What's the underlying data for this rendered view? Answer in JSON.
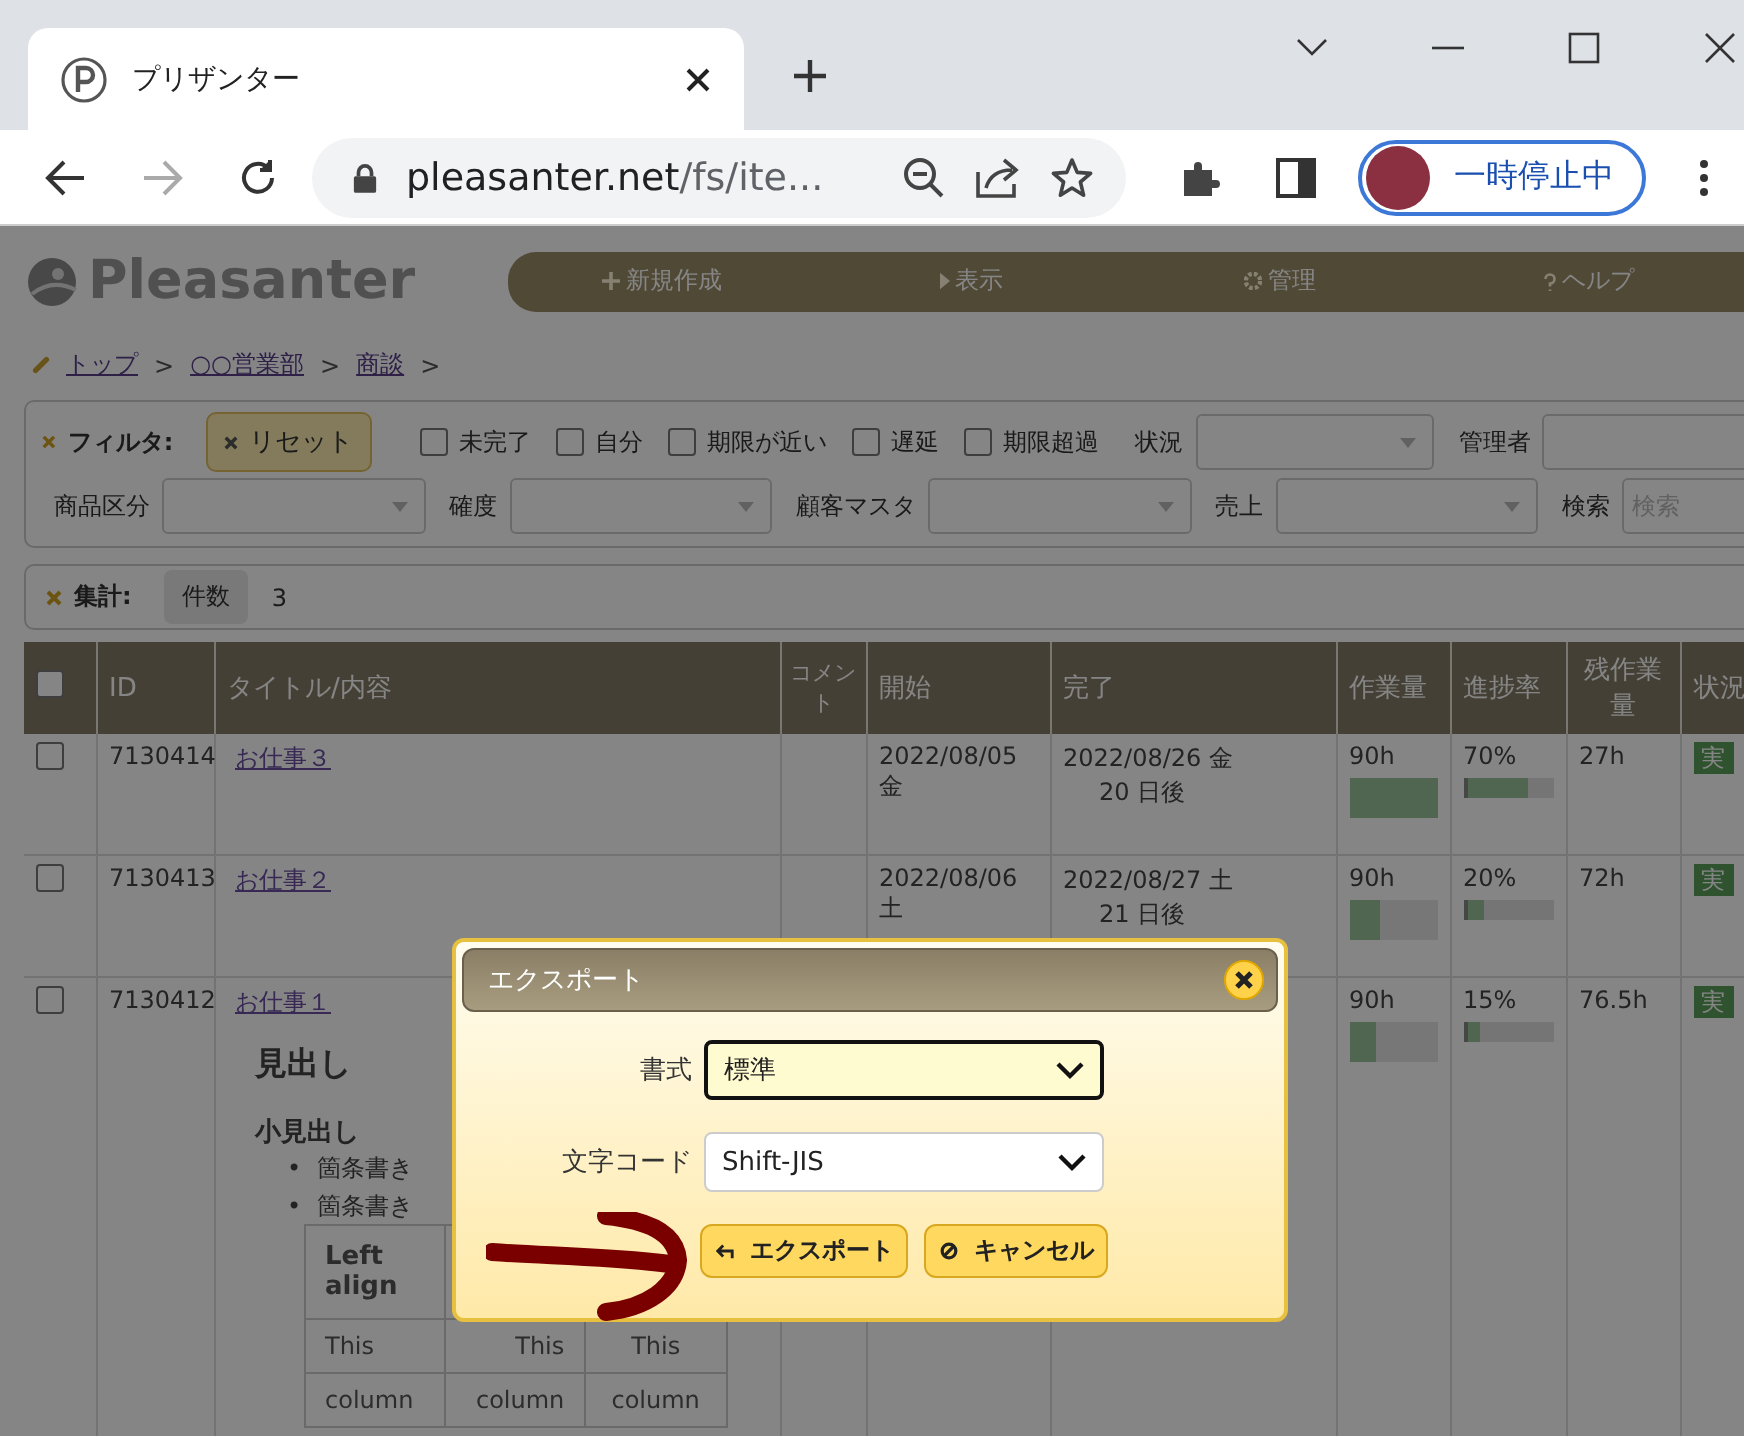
{
  "browser": {
    "tab": {
      "title": "プリザンター"
    },
    "nav_buttons": [
      {
        "kind": "back",
        "disabled": false
      },
      {
        "kind": "forward",
        "disabled": true
      },
      {
        "kind": "reload",
        "disabled": false
      }
    ],
    "url": {
      "host": "pleasanter.net",
      "path": "/fs/ite..."
    },
    "profile": {
      "label": "一時停止中"
    }
  },
  "site": {
    "logo": "Pleasanter",
    "nav": [
      {
        "kind": "new",
        "label": "新規作成"
      },
      {
        "kind": "view",
        "label": "表示"
      },
      {
        "kind": "manage",
        "label": "管理"
      },
      {
        "kind": "help",
        "label": "ヘルプ"
      }
    ]
  },
  "breadcrumb": {
    "separator": ">",
    "items": [
      "トップ",
      "○○営業部",
      "商談"
    ]
  },
  "filter": {
    "label": "フィルタ:",
    "reset": "リセット",
    "checks": [
      {
        "label": "未完了",
        "checked": false
      },
      {
        "label": "自分",
        "checked": false
      },
      {
        "label": "期限が近い",
        "checked": false
      },
      {
        "label": "遅延",
        "checked": false
      },
      {
        "label": "期限超過",
        "checked": false
      }
    ],
    "fields": [
      {
        "kind": "select",
        "label": "状況"
      },
      {
        "kind": "select",
        "label": "管理者"
      },
      {
        "kind": "select",
        "label": "商品区分"
      },
      {
        "kind": "select",
        "label": "確度"
      },
      {
        "kind": "select",
        "label": "顧客マスタ"
      },
      {
        "kind": "select",
        "label": "売上"
      },
      {
        "kind": "search",
        "label": "検索",
        "placeholder": "検索"
      }
    ]
  },
  "aggregation": {
    "label": "集計:",
    "chips": [
      {
        "label": "件数",
        "value": "3"
      }
    ]
  },
  "table": {
    "select_all_checked": false,
    "columns": [
      "ID",
      "タイトル/内容",
      "コメント",
      "開始",
      "完了",
      "作業量",
      "進捗率",
      "残作業量",
      "状況"
    ],
    "rows": [
      {
        "checked": false,
        "id": "7130414",
        "title": "お仕事３",
        "start": "2022/08/05 金",
        "end": "2022/08/26 金",
        "end_note": "20 日後",
        "work": {
          "text": "90h",
          "level": 1.0
        },
        "progress": {
          "text": "70%",
          "level": 0.7
        },
        "remaining": "27h",
        "status": "実"
      },
      {
        "checked": false,
        "id": "7130413",
        "title": "お仕事２",
        "start": "2022/08/06 土",
        "end": "2022/08/27 土",
        "end_note": "21 日後",
        "work": {
          "text": "90h",
          "level": 0.35
        },
        "progress": {
          "text": "20%",
          "level": 0.2
        },
        "remaining": "72h",
        "status": "実"
      },
      {
        "checked": false,
        "id": "7130412",
        "title": "お仕事１",
        "work": {
          "text": "90h",
          "level": 0.3
        },
        "progress": {
          "text": "15%",
          "level": 0.15
        },
        "remaining": "76.5h",
        "status": "実",
        "body": {
          "heading": "見出し",
          "subheading": "小見出し",
          "bullets": [
            {
              "marker": "•",
              "text": "箇条書き"
            },
            {
              "marker": "•",
              "text": "箇条書き"
            }
          ],
          "table": {
            "header": "Left align",
            "rows": [
              [
                "This",
                "This",
                "This"
              ],
              [
                "column",
                "column",
                "column"
              ]
            ]
          }
        }
      }
    ]
  },
  "dialog": {
    "title": "エクスポート",
    "fields": [
      {
        "label": "書式",
        "value": "標準",
        "focused": true
      },
      {
        "label": "文字コード",
        "value": "Shift-JIS",
        "focused": false
      }
    ],
    "buttons": [
      {
        "kind": "export",
        "label": "エクスポート"
      },
      {
        "kind": "cancel",
        "label": "キャンセル"
      }
    ]
  }
}
